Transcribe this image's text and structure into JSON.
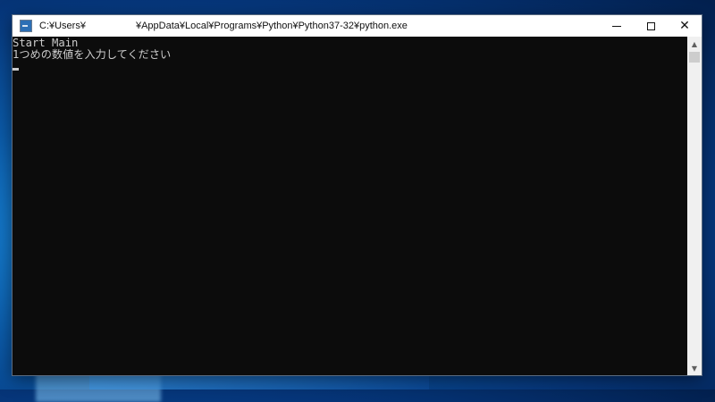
{
  "window": {
    "title_left": "C:¥Users¥",
    "title_right": "¥AppData¥Local¥Programs¥Python¥Python37-32¥python.exe"
  },
  "console": {
    "lines": [
      "Start Main",
      "1つめの数値を入力してください"
    ]
  },
  "controls": {
    "minimize": "",
    "maximize": "",
    "close": "✕"
  },
  "scrollbar": {
    "up_arrow": "▲",
    "down_arrow": "▼"
  }
}
